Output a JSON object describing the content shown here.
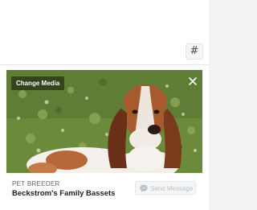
{
  "toolbar": {
    "hash_label": "#"
  },
  "card": {
    "change_media_label": "Change Media",
    "category": "PET BREEDER",
    "page_name": "Beckstrom's Family Bassets",
    "send_message_label": "Send Message"
  },
  "icons": {
    "close": "close-icon",
    "messenger": "messenger-icon"
  },
  "colors": {
    "page_background": "#f2f3f5",
    "text_primary": "#1c1e21",
    "text_secondary": "#606770",
    "disabled_text": "#bcc0c4"
  }
}
